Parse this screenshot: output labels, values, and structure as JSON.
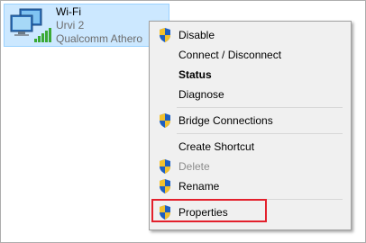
{
  "adapter": {
    "name": "Wi-Fi",
    "network": "Urvi 2",
    "device": "Qualcomm Athero"
  },
  "menu": {
    "items": [
      {
        "label": "Disable",
        "shield": true,
        "style": "normal"
      },
      {
        "label": "Connect / Disconnect",
        "shield": false,
        "style": "normal"
      },
      {
        "label": "Status",
        "shield": false,
        "style": "bold"
      },
      {
        "label": "Diagnose",
        "shield": false,
        "style": "normal"
      },
      {
        "label": "Bridge Connections",
        "shield": true,
        "style": "normal"
      },
      {
        "label": "Create Shortcut",
        "shield": false,
        "style": "normal"
      },
      {
        "label": "Delete",
        "shield": true,
        "style": "disabled"
      },
      {
        "label": "Rename",
        "shield": true,
        "style": "normal"
      },
      {
        "label": "Properties",
        "shield": true,
        "style": "normal",
        "highlighted": true
      }
    ]
  },
  "colors": {
    "selection_bg": "#cce8ff",
    "selection_border": "#99d1ff",
    "menu_bg": "#f0f0f0",
    "highlight_border": "#e3202c",
    "signal_green": "#3aa935"
  }
}
